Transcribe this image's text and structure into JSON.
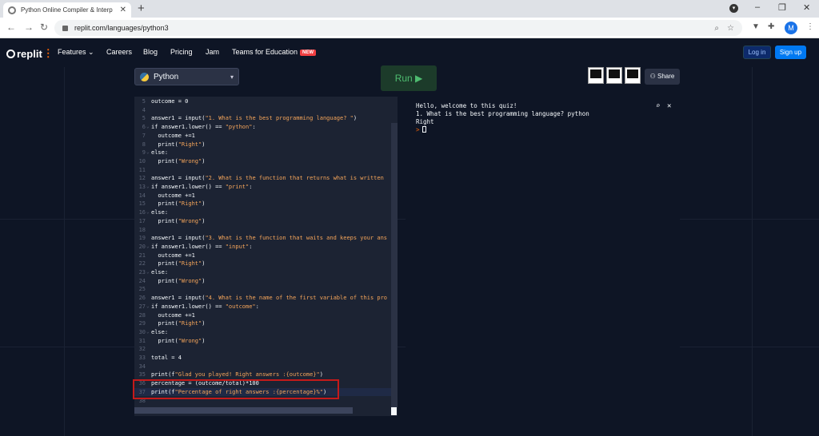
{
  "browser": {
    "tab_title": "Python Online Compiler & Interp",
    "tab_close": "✕",
    "new_tab": "+",
    "url": "replit.com/languages/python3",
    "profile_initial": "M",
    "window_minimize": "–",
    "window_restore": "❐",
    "window_close": "✕"
  },
  "header": {
    "logo": "replit",
    "logo_dots": "⋮",
    "menu": [
      {
        "label": "Features ⌄"
      },
      {
        "label": "Careers"
      },
      {
        "label": "Blog"
      },
      {
        "label": "Pricing"
      },
      {
        "label": "Jam"
      },
      {
        "label": "Teams for Education"
      }
    ],
    "new_badge": "NEW",
    "login": "Log in",
    "signup": "Sign up"
  },
  "toolbar": {
    "language": "Python",
    "run": "Run ▶",
    "share": "Share"
  },
  "editor": {
    "lines": [
      {
        "n": "5",
        "fold": "",
        "code": "outcome = 0",
        "active": false
      },
      {
        "n": "4",
        "fold": "",
        "code": "",
        "active": false
      },
      {
        "n": "5",
        "fold": "",
        "code": "answer1 = input(\"1. What is the best programming language? \")",
        "active": false
      },
      {
        "n": "6",
        "fold": "⌄",
        "code": "if answer1.lower() == \"python\":",
        "active": false
      },
      {
        "n": "7",
        "fold": "",
        "code": "  outcome +=1",
        "active": false
      },
      {
        "n": "8",
        "fold": "",
        "code": "  print(\"Right\")",
        "active": false
      },
      {
        "n": "9",
        "fold": "⌄",
        "code": "else:",
        "active": false
      },
      {
        "n": "10",
        "fold": "",
        "code": "  print(\"Wrong\")",
        "active": false
      },
      {
        "n": "11",
        "fold": "",
        "code": "",
        "active": false
      },
      {
        "n": "12",
        "fold": "",
        "code": "answer1 = input(\"2. What is the function that returns what is written",
        "active": false
      },
      {
        "n": "13",
        "fold": "⌄",
        "code": "if answer1.lower() == \"print\":",
        "active": false
      },
      {
        "n": "14",
        "fold": "",
        "code": "  outcome +=1",
        "active": false
      },
      {
        "n": "15",
        "fold": "",
        "code": "  print(\"Right\")",
        "active": false
      },
      {
        "n": "16",
        "fold": "⌄",
        "code": "else:",
        "active": false
      },
      {
        "n": "17",
        "fold": "",
        "code": "  print(\"Wrong\")",
        "active": false
      },
      {
        "n": "18",
        "fold": "",
        "code": "",
        "active": false
      },
      {
        "n": "19",
        "fold": "",
        "code": "answer1 = input(\"3. What is the function that waits and keeps your ans",
        "active": false
      },
      {
        "n": "20",
        "fold": "⌄",
        "code": "if answer1.lower() == \"input\":",
        "active": false
      },
      {
        "n": "21",
        "fold": "",
        "code": "  outcome +=1",
        "active": false
      },
      {
        "n": "22",
        "fold": "",
        "code": "  print(\"Right\")",
        "active": false
      },
      {
        "n": "23",
        "fold": "⌄",
        "code": "else:",
        "active": false
      },
      {
        "n": "24",
        "fold": "",
        "code": "  print(\"Wrong\")",
        "active": false
      },
      {
        "n": "25",
        "fold": "",
        "code": "",
        "active": false
      },
      {
        "n": "26",
        "fold": "",
        "code": "answer1 = input(\"4. What is the name of the first variable of this pro",
        "active": false
      },
      {
        "n": "27",
        "fold": "⌄",
        "code": "if answer1.lower() == \"outcome\":",
        "active": false
      },
      {
        "n": "28",
        "fold": "",
        "code": "  outcome +=1",
        "active": false
      },
      {
        "n": "29",
        "fold": "",
        "code": "  print(\"Right\")",
        "active": false
      },
      {
        "n": "30",
        "fold": "⌄",
        "code": "else:",
        "active": false
      },
      {
        "n": "31",
        "fold": "",
        "code": "  print(\"Wrong\")",
        "active": false
      },
      {
        "n": "32",
        "fold": "",
        "code": "",
        "active": false
      },
      {
        "n": "33",
        "fold": "",
        "code": "total = 4",
        "active": false
      },
      {
        "n": "34",
        "fold": "",
        "code": "",
        "active": false
      },
      {
        "n": "35",
        "fold": "",
        "code": "print(f\"Glad you played! Right answers :{outcome}\")",
        "active": false
      },
      {
        "n": "36",
        "fold": "",
        "code": "percentage = (outcome/total)*100",
        "active": false
      },
      {
        "n": "37",
        "fold": "",
        "code": "print(f\"Percentage of right answers :{percentage}%\")",
        "active": true
      },
      {
        "n": "38",
        "fold": "",
        "code": "",
        "active": false
      }
    ]
  },
  "console": {
    "lines": [
      "Hello, welcome to this quiz!",
      "1. What is the best programming language? python",
      "Right"
    ],
    "prompt": ">",
    "search_icon": "⌕",
    "clear_icon": "✕"
  },
  "colors": {
    "bg": "#0e1525",
    "editor_bg": "#1c2333",
    "accent": "#f26207",
    "run_green": "#4ebc70",
    "highlight_red": "#c41a1a",
    "signup_blue": "#0079f2"
  }
}
